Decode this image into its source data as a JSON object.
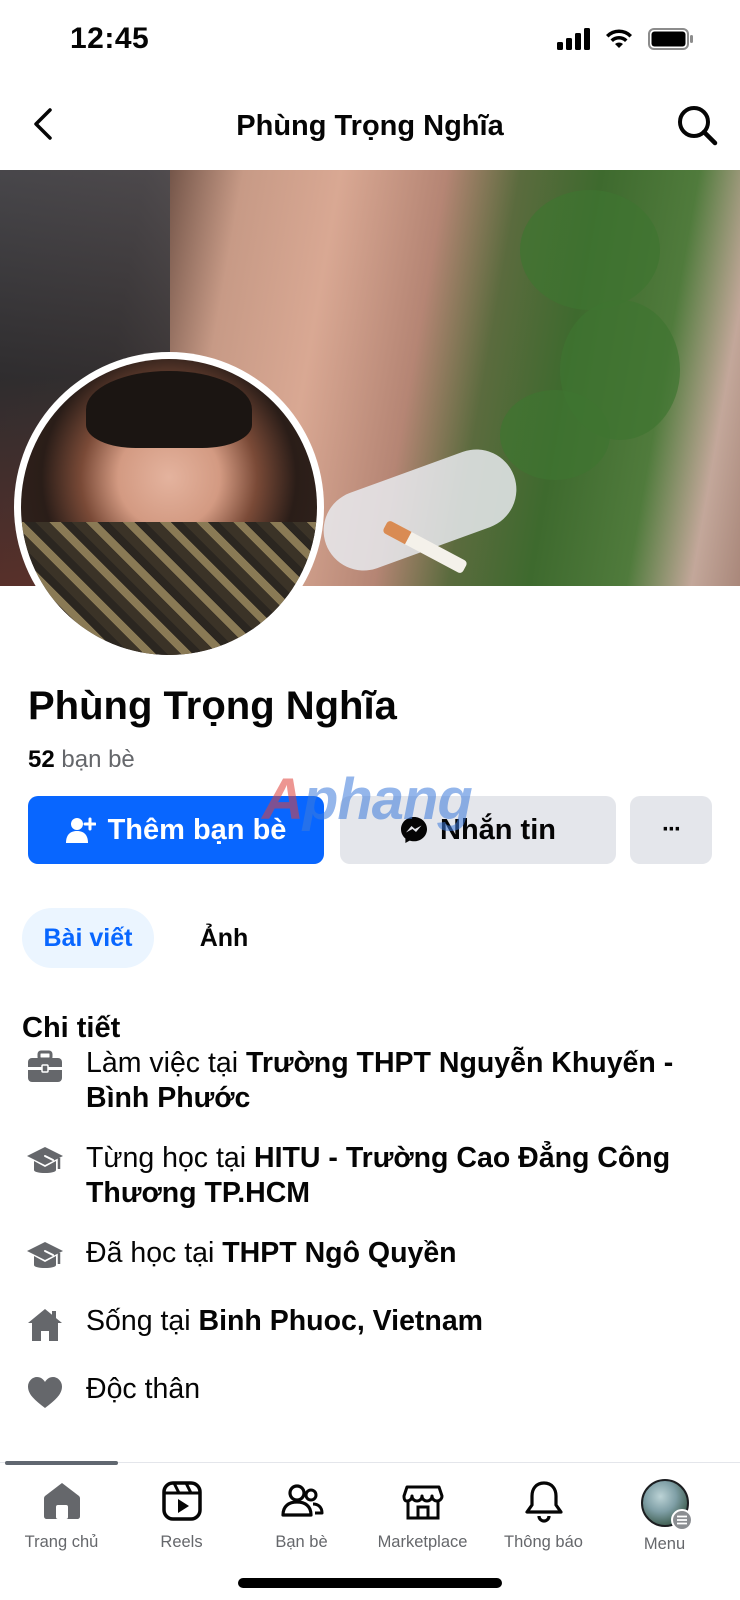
{
  "status_bar": {
    "time": "12:45"
  },
  "header": {
    "title": "Phùng Trọng Nghĩa"
  },
  "profile": {
    "name": "Phùng Trọng Nghĩa",
    "friends_count": "52",
    "friends_label": "bạn bè"
  },
  "actions": {
    "add_friend": "Thêm bạn bè",
    "message": "Nhắn tin",
    "more": "···"
  },
  "watermark": {
    "first": "A",
    "rest": "phang"
  },
  "tabs": [
    {
      "label": "Bài viết",
      "active": true
    },
    {
      "label": "Ảnh",
      "active": false
    }
  ],
  "details": {
    "title": "Chi tiết",
    "items": [
      {
        "icon": "briefcase-icon",
        "prefix": "Làm việc tại ",
        "bold": "Trường THPT Nguyễn Khuyến - Bình Phước"
      },
      {
        "icon": "graduation-cap-icon",
        "prefix": "Từng học tại ",
        "bold": "HITU - Trường Cao Đẳng Công Thương TP.HCM"
      },
      {
        "icon": "graduation-cap-icon",
        "prefix": "Đã học tại ",
        "bold": "THPT Ngô Quyền"
      },
      {
        "icon": "home-icon",
        "prefix": "Sống tại ",
        "bold": "Binh Phuoc, Vietnam"
      },
      {
        "icon": "heart-icon",
        "prefix": "Độc thân",
        "bold": ""
      }
    ]
  },
  "bottom_nav": [
    {
      "label": "Trang chủ",
      "icon": "home-nav-icon",
      "active": true
    },
    {
      "label": "Reels",
      "icon": "reels-icon",
      "active": false
    },
    {
      "label": "Bạn bè",
      "icon": "friends-icon",
      "active": false
    },
    {
      "label": "Marketplace",
      "icon": "marketplace-icon",
      "active": false
    },
    {
      "label": "Thông báo",
      "icon": "bell-icon",
      "active": false
    },
    {
      "label": "Menu",
      "icon": "profile-avatar",
      "active": false
    }
  ],
  "colors": {
    "accent": "#0866ff",
    "secondary_button": "#e4e6eb",
    "tab_active_bg": "#ebf5ff",
    "muted_text": "#65676b"
  }
}
